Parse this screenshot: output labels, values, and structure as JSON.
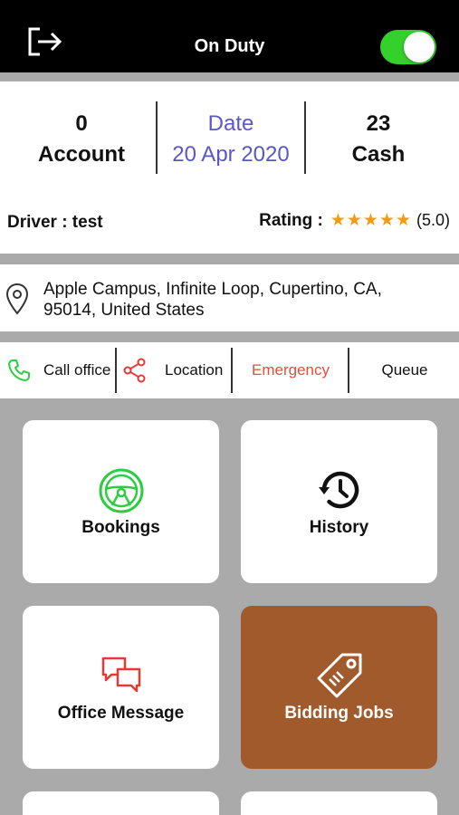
{
  "header": {
    "title": "On Duty",
    "duty_toggle_on": true
  },
  "stats": {
    "account": {
      "value": "0",
      "label": "Account"
    },
    "date": {
      "label": "Date",
      "value": "20 Apr 2020"
    },
    "cash": {
      "value": "23",
      "label": "Cash"
    }
  },
  "driver": {
    "text": "Driver : test"
  },
  "rating": {
    "label": "Rating :",
    "stars": "★★★★★",
    "value": "(5.0)",
    "score": 5
  },
  "address": {
    "line1": "Apple Campus, Infinite Loop, Cupertino, CA,",
    "line2": "95014, United States"
  },
  "actions": {
    "call": "Call office",
    "location": "Location",
    "emergency": "Emergency",
    "queue": "Queue"
  },
  "tiles": {
    "bookings": "Bookings",
    "history": "History",
    "office_message": "Office Message",
    "bidding_jobs": "Bidding Jobs"
  },
  "icons": {
    "logout": "logout-icon",
    "location_pin": "location-pin-icon",
    "phone": "phone-icon",
    "share": "share-icon",
    "steering_wheel": "steering-wheel-icon",
    "history": "history-icon",
    "chat": "chat-icon",
    "tag": "tag-icon"
  },
  "colors": {
    "topbar": "#000000",
    "toggle_on": "#34d02b",
    "date_text": "#5b57c6",
    "emergency": "#e74c3c",
    "phone_icon": "#2ecc40",
    "share_icon": "#e53935",
    "bookings_icon": "#2ecc40",
    "chat_icon": "#e53935",
    "bidding_tile": "#a05a2c",
    "star": "#f39c12",
    "background": "#aaaaaa"
  }
}
